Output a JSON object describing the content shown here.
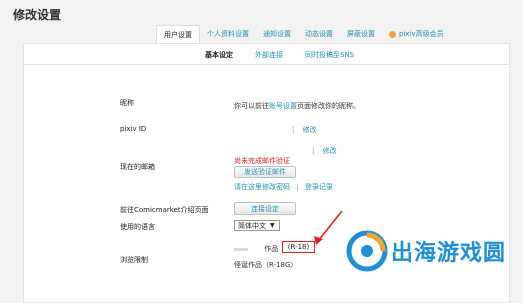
{
  "page": {
    "title": "修改设置"
  },
  "tabs": [
    {
      "label": "用户设置",
      "active": true
    },
    {
      "label": "个人资料设置",
      "active": false
    },
    {
      "label": "通知设置",
      "active": false
    },
    {
      "label": "动态设置",
      "active": false
    },
    {
      "label": "屏蔽设置",
      "active": false
    },
    {
      "label": "pixiv高级会员",
      "active": false,
      "icon": "pixiv-premium-icon"
    }
  ],
  "subtabs": [
    {
      "label": "基本设定",
      "active": true
    },
    {
      "label": "外部连接",
      "active": false
    },
    {
      "label": "同时投稿至SNS",
      "active": false
    }
  ],
  "rows": {
    "nickname": {
      "label": "昵称",
      "text_before": "你可以前往",
      "link": "账号设置",
      "text_after": "页面修改你的昵称。"
    },
    "pixiv_id": {
      "label": "pixiv ID",
      "sep": "|",
      "edit": "修改"
    },
    "email": {
      "label": "现在的邮箱",
      "sep": "|",
      "edit": "修改",
      "warning": "尚未完成邮件验证",
      "send_button": "发送验证邮件",
      "change_pw": "请在这里修改密码",
      "sep2": "|",
      "login_history": "登录记录"
    },
    "comicmarket": {
      "label": "前往Comicmarket介绍页面",
      "button": "连接设定"
    },
    "language": {
      "label": "使用的语言",
      "selected": "简体中文"
    },
    "content": {
      "label": "浏览限制",
      "line1_text": "作品",
      "line1_tag": "(R-18)",
      "line2_text": "怪诞作品（R-18G）"
    }
  },
  "watermark": {
    "text": "出海游戏圆"
  },
  "colors": {
    "link": "#258fb8",
    "warning": "#e02020",
    "watermark": "#1e8fd6"
  }
}
